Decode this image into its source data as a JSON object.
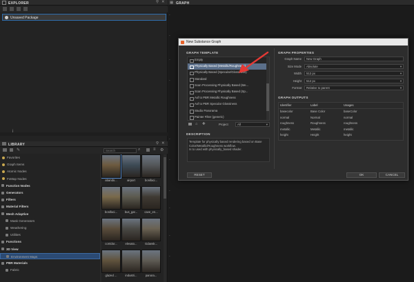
{
  "explorer": {
    "title": "EXPLORER",
    "package": "Unsaved Package"
  },
  "graph_panel": {
    "title": "GRAPH"
  },
  "library": {
    "title": "LIBRARY",
    "search_placeholder": "Search",
    "categories": [
      {
        "label": "Favorites",
        "level": 0
      },
      {
        "label": "Graph Items",
        "level": 0
      },
      {
        "label": "Atomic Nodes",
        "level": 0
      },
      {
        "label": "FxMap Nodes",
        "level": 0
      },
      {
        "label": "Function Nodes",
        "level": 1
      },
      {
        "label": "Generators",
        "level": 1
      },
      {
        "label": "Filters",
        "level": 1
      },
      {
        "label": "Material Filters",
        "level": 1
      },
      {
        "label": "Mesh Adaptive",
        "level": 1
      },
      {
        "label": "Mask Generators",
        "level": 2
      },
      {
        "label": "Weathering",
        "level": 2
      },
      {
        "label": "Utilities",
        "level": 2
      },
      {
        "label": "Functions",
        "level": 1
      },
      {
        "label": "3D View",
        "level": 1
      },
      {
        "label": "Environment Maps",
        "level": 2
      },
      {
        "label": "PBR Materials",
        "level": 1
      },
      {
        "label": "Fabric",
        "level": 2
      }
    ],
    "thumbnails": [
      [
        "abando...",
        "airport",
        "bonifaci..."
      ],
      [
        "bonifaci...",
        "bus_gar...",
        "cave_en..."
      ],
      [
        "corridor...",
        "elevato...",
        "Gdansk..."
      ],
      [
        "glazed ...",
        "industri...",
        "panora..."
      ]
    ],
    "thumb_colors": [
      [
        "#6d5a3f",
        "#3d4a55",
        "#54575a"
      ],
      [
        "#7a6a4b",
        "#5c5a4f",
        "#3f3a33"
      ],
      [
        "#5a4d3c",
        "#4a4945",
        "#6a6253"
      ],
      [
        "#61543e",
        "#56524a",
        "#5f5c55"
      ]
    ]
  },
  "dialog": {
    "title": "New Substance Graph",
    "template_heading": "GRAPH TEMPLATE",
    "templates": [
      "Empty",
      "Physically Based (Metallic/Roughness)",
      "Physically Based (Specular/Glossiness)",
      "Standard",
      "Scan Processing Physically Based (Me...",
      "Scan Processing Physically Based (Sp...",
      "Axf to PBR Metallic Roughness",
      "Axf to PBR Specular Glossiness",
      "Studio Panorama",
      "Painter Filter (generic)"
    ],
    "selected_template": 1,
    "project_label": "Project",
    "project_value": "All",
    "description_heading": "DESCRIPTION",
    "description": "Template for physically based rendering based on Base Color/Metallic/Roughness workflow.\nIs to used with physically_based shader.",
    "reset_label": "RESET",
    "properties_heading": "GRAPH PROPERTIES",
    "properties": [
      {
        "label": "Graph Name",
        "value": "New Graph"
      },
      {
        "label": "Size Mode",
        "value": "Absolute"
      },
      {
        "label": "Width",
        "value": "512 px"
      },
      {
        "label": "Height",
        "value": "512 px"
      },
      {
        "label": "Format",
        "value": "Relative to parent"
      }
    ],
    "outputs_heading": "GRAPH OUTPUTS",
    "outputs_columns": [
      "Identifier",
      "Label",
      "Usages"
    ],
    "outputs": [
      [
        "basecolor",
        "Base Color",
        "baseColor"
      ],
      [
        "normal",
        "Normal",
        "normal"
      ],
      [
        "roughness",
        "Roughness",
        "roughness"
      ],
      [
        "metallic",
        "Metallic",
        "metallic"
      ],
      [
        "height",
        "Height",
        "height"
      ]
    ],
    "ok_label": "OK",
    "cancel_label": "CANCEL"
  },
  "colors": {
    "accent": "#2b4a73",
    "selection": "#5b6f8a",
    "annotation_arrow": "#e53935"
  }
}
